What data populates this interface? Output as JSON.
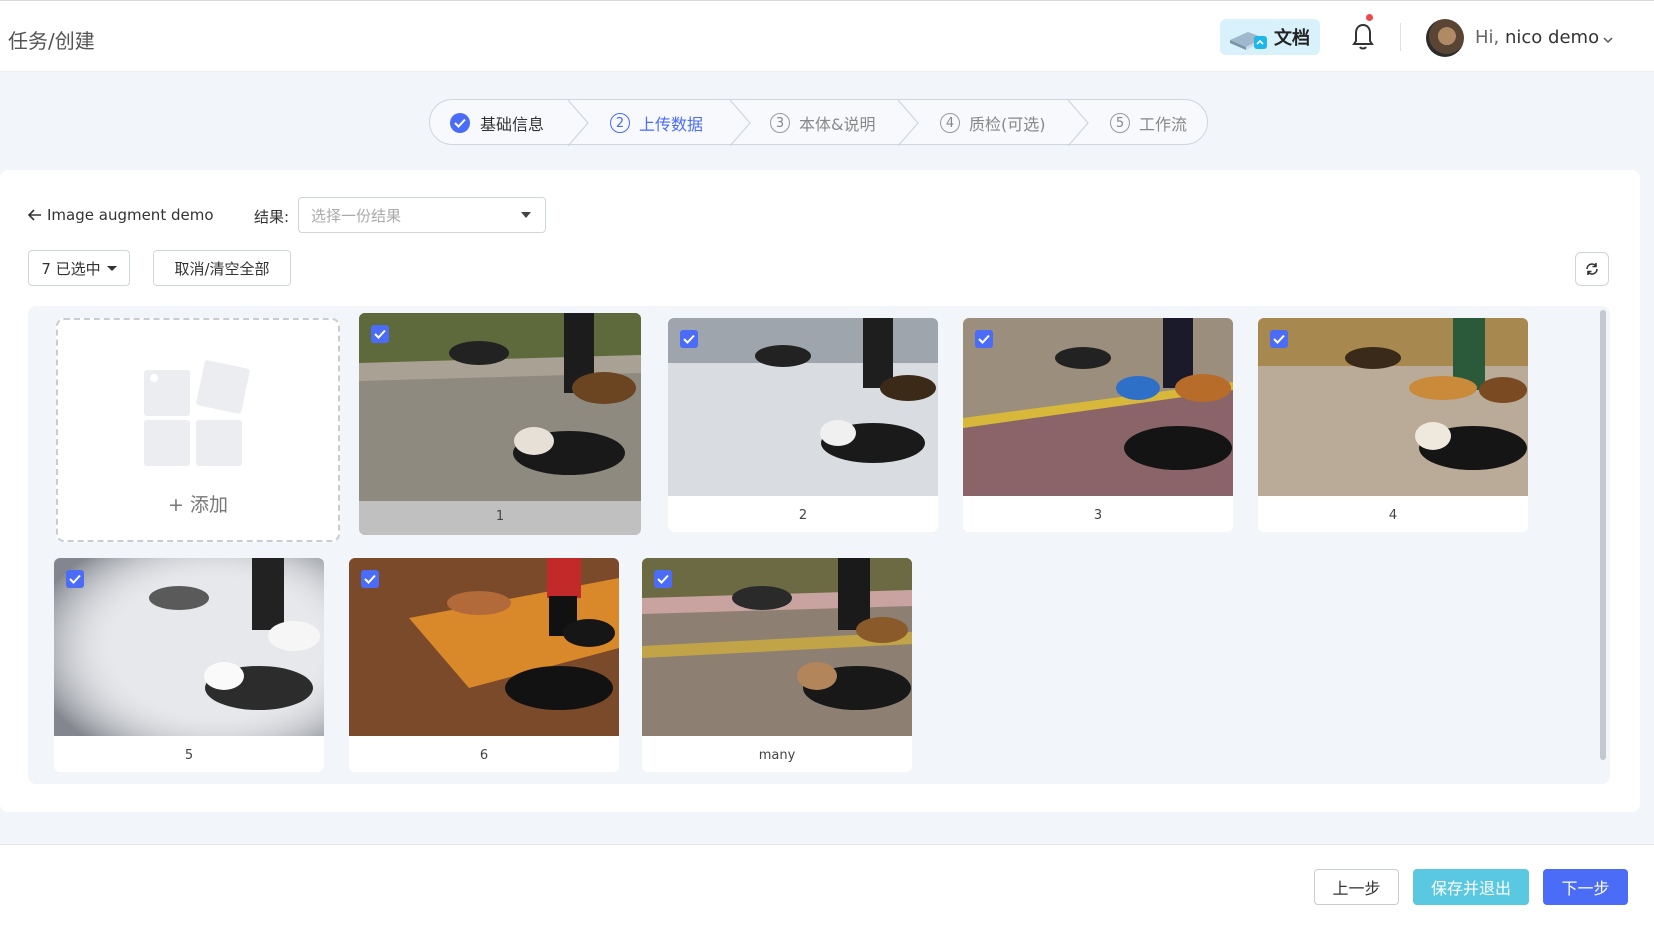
{
  "header": {
    "breadcrumb": "任务/创建",
    "doc_label": "文档",
    "user_greeting": "Hi,",
    "user_name": "nico demo"
  },
  "stepper": {
    "steps": [
      {
        "num": "1",
        "label": "基础信息",
        "state": "done"
      },
      {
        "num": "2",
        "label": "上传数据",
        "state": "active"
      },
      {
        "num": "3",
        "label": "本体&说明",
        "state": "pending"
      },
      {
        "num": "4",
        "label": "质检(可选)",
        "state": "pending"
      },
      {
        "num": "5",
        "label": "工作流",
        "state": "pending"
      }
    ]
  },
  "toolbar": {
    "back_label": "Image augment demo",
    "result_label": "结果:",
    "result_placeholder": "选择一份结果",
    "selected_label": "7 已选中",
    "clear_label": "取消/清空全部"
  },
  "gallery": {
    "add_label": "+ 添加",
    "items": [
      {
        "label": "1"
      },
      {
        "label": "2"
      },
      {
        "label": "3"
      },
      {
        "label": "4"
      },
      {
        "label": "5"
      },
      {
        "label": "6"
      },
      {
        "label": "many"
      }
    ]
  },
  "footer": {
    "prev_label": "上一步",
    "save_label": "保存并退出",
    "next_label": "下一步"
  },
  "colors": {
    "primary": "#4a6cf7",
    "save": "#5ac8e0"
  }
}
